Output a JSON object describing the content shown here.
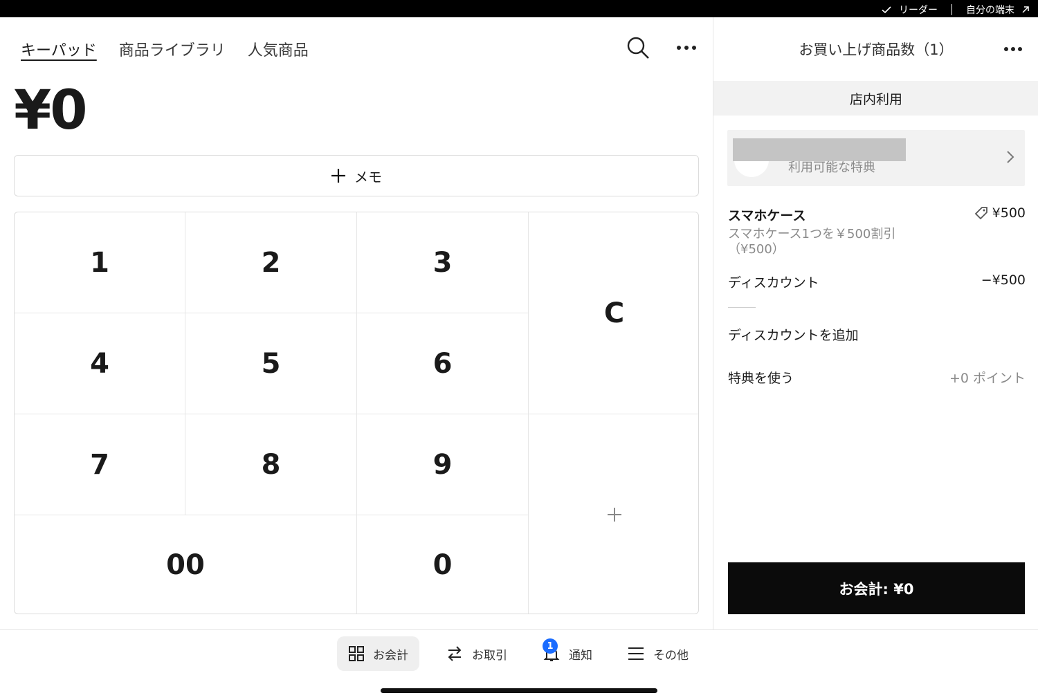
{
  "status_bar": {
    "reader": "リーダー",
    "device": "自分の端末"
  },
  "tabs": [
    "キーパッド",
    "商品ライブラリ",
    "人気商品"
  ],
  "amount": "¥0",
  "memo_label": "メモ",
  "keypad": {
    "k1": "1",
    "k2": "2",
    "k3": "3",
    "k4": "4",
    "k5": "5",
    "k6": "6",
    "k7": "7",
    "k8": "8",
    "k9": "9",
    "k00": "00",
    "k0": "0",
    "clear": "C",
    "add": "+"
  },
  "cart": {
    "header": "お買い上げ商品数（1）",
    "dining_option": "店内利用",
    "promo_text": "利用可能な特典",
    "item": {
      "name": "スマホケース",
      "price": "¥500",
      "desc_line1": "スマホケース1つを￥500割引",
      "desc_line2": "（¥500）"
    },
    "discount_label": "ディスカウント",
    "discount_value": "−¥500",
    "add_discount": "ディスカウントを追加",
    "use_rewards": "特典を使う",
    "points": "+0 ポイント",
    "checkout": "お会計: ¥0"
  },
  "bottom_nav": {
    "checkout": "お会計",
    "transactions": "お取引",
    "notifications": "通知",
    "notification_count": "1",
    "more": "その他"
  },
  "colors": {
    "accent": "#1a6cff",
    "checkout_bg": "#0b0b0b",
    "panel_bg": "#f2f2f2"
  },
  "icons": [
    "check-icon",
    "external-link-icon",
    "search-icon",
    "more-icon",
    "plus-icon",
    "chevron-right-icon",
    "tag-icon",
    "grid-icon",
    "swap-icon",
    "bell-icon",
    "menu-icon"
  ]
}
